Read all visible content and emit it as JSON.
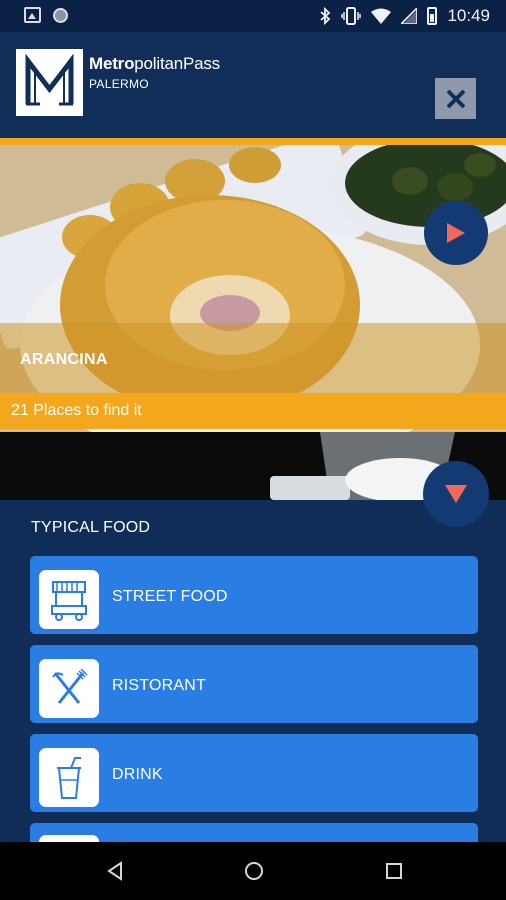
{
  "status_bar": {
    "time": "10:49",
    "left_icons": [
      "image-icon",
      "circle-icon"
    ],
    "right_icons": [
      "bluetooth-icon",
      "vibrate-icon",
      "wifi-icon",
      "signal-icon",
      "battery-icon"
    ]
  },
  "header": {
    "brand_bold": "Metro",
    "brand_rest": "politanPass",
    "city": "PALERMO",
    "logo_letter": "M",
    "close_icon": "close-icon"
  },
  "hero": {
    "title": "ARANCINA",
    "places": "21 Places to find it",
    "play_icon": "play-icon"
  },
  "panel": {
    "toggle_icon": "triangle-down-icon",
    "section_title": "TYPICAL FOOD",
    "categories": [
      {
        "label": "STREET FOOD",
        "icon": "food-cart-icon"
      },
      {
        "label": "RISTORANT",
        "icon": "fork-knife-icon"
      },
      {
        "label": "DRINK",
        "icon": "drink-cup-icon"
      },
      {
        "label": "",
        "icon": "partial-icon"
      }
    ]
  },
  "nav": {
    "items": [
      "back-icon",
      "home-icon",
      "recents-icon"
    ]
  },
  "colors": {
    "header_bg": "#102e58",
    "accent_orange": "#f3a71c",
    "button_blue": "#2a7de2",
    "circle_btn": "#143a74",
    "play_red": "#f2685b"
  }
}
